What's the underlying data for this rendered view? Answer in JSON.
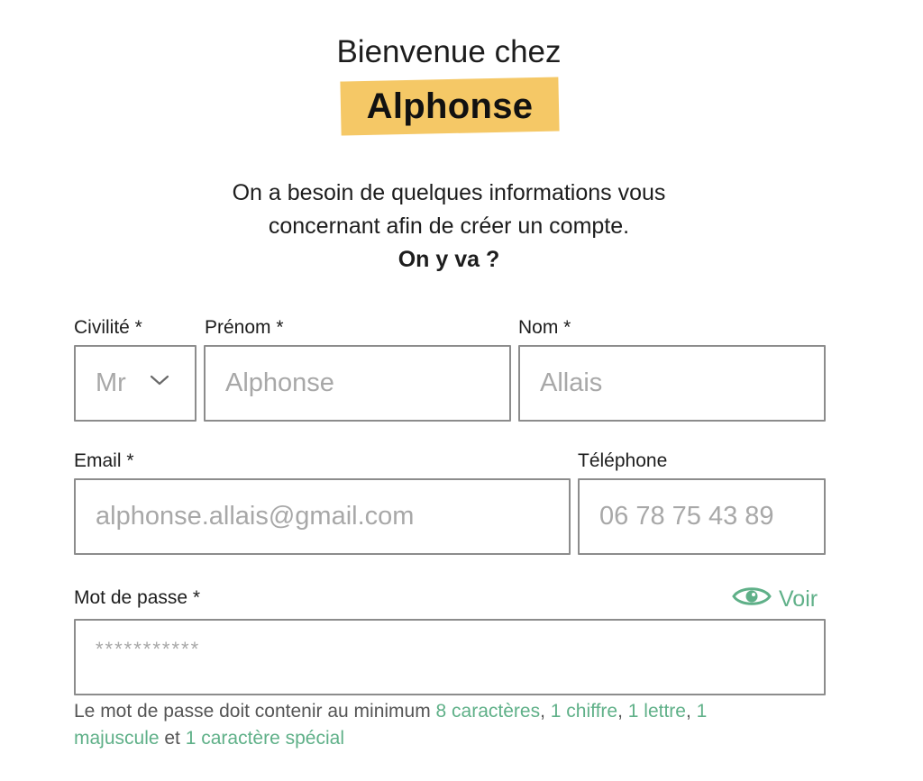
{
  "header": {
    "welcome": "Bienvenue chez",
    "brand": "Alphonse"
  },
  "intro": {
    "line1": "On a besoin de quelques informations vous",
    "line2": "concernant afin de créer un compte.",
    "cta": "On y va ?"
  },
  "form": {
    "civilite": {
      "label": "Civilité *",
      "value": "Mr"
    },
    "prenom": {
      "label": "Prénom *",
      "placeholder": "Alphonse"
    },
    "nom": {
      "label": "Nom *",
      "placeholder": "Allais"
    },
    "email": {
      "label": "Email *",
      "placeholder": "alphonse.allais@gmail.com"
    },
    "telephone": {
      "label": "Téléphone",
      "placeholder": "06 78 75 43 89"
    },
    "password": {
      "label": "Mot de passe *",
      "placeholder": "***********",
      "show_label": "Voir"
    }
  },
  "password_rules": {
    "prefix": "Le mot de passe doit contenir au minimum ",
    "rule1": "8 caractères",
    "sep1": ", ",
    "rule2": "1 chiffre",
    "sep2": ", ",
    "rule3": "1 lettre",
    "sep3": ", ",
    "rule4": "1 majuscule",
    "sep4": " et ",
    "rule5": "1 caractère spécial"
  },
  "colors": {
    "brand_highlight": "#f5c866",
    "accent_green": "#5fb088",
    "border": "#8c8c8c",
    "placeholder": "#a8a8a8"
  },
  "icons": {
    "civilite_dropdown": "chevron-down-icon",
    "show_password": "eye-icon"
  }
}
